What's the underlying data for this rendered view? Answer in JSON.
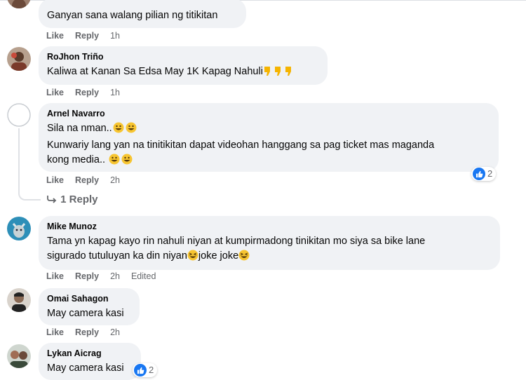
{
  "actions": {
    "like": "Like",
    "reply": "Reply",
    "edited": "Edited"
  },
  "comments": [
    {
      "author": "",
      "lines": [
        "Ganyan sana walang pilian ng titikitan"
      ],
      "time": "1h"
    },
    {
      "author": "RoJhon Triño",
      "lines": [
        "Kaliwa at Kanan Sa Edsa May 1K Kapag Nahuli"
      ],
      "time": "1h"
    },
    {
      "author": "Arnel Navarro",
      "lines": [
        "Sila na nman..",
        "Kunwariy lang yan na tinitikitan dapat videohan hanggang sa pag ticket mas maganda",
        "kong media.."
      ],
      "time": "2h",
      "reaction": {
        "icon": "like-icon",
        "count": "2"
      },
      "replies_link": "1 Reply"
    },
    {
      "author": "Mike Munoz",
      "lines": [
        "Tama yn kapag kayo rin nahuli niyan at kumpirmadong tinikitan mo siya sa bike lane",
        "sigurado tutuluyan ka din niyan",
        "joke joke"
      ],
      "time": "2h",
      "edited": true
    },
    {
      "author": "Omai Sahagon",
      "lines": [
        "May camera kasi"
      ],
      "time": "2h"
    },
    {
      "author": "Lykan Aicrag",
      "lines": [
        "May camera kasi"
      ],
      "time": "",
      "reaction": {
        "icon": "like-icon",
        "count": "2"
      }
    }
  ],
  "colors": {
    "bubble": "#f0f2f5",
    "meta": "#65676b",
    "like_blue": "#1877f2"
  }
}
